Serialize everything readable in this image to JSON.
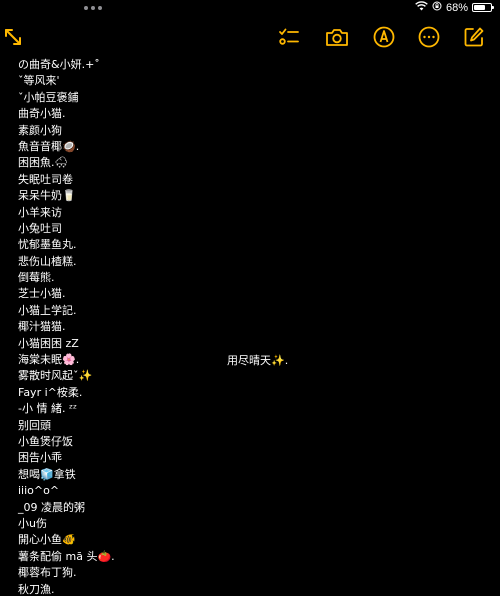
{
  "status_bar": {
    "battery_percent": "68%",
    "battery_level": 0.68,
    "icons": [
      "wifi-icon",
      "lock-rotation-icon",
      "battery-icon"
    ]
  },
  "toolbar": {
    "left": [
      "collapse-icon"
    ],
    "right": [
      "checklist-icon",
      "camera-icon",
      "markup-pen-icon",
      "more-icon",
      "compose-icon"
    ],
    "accent_color": "#ffb800"
  },
  "note": {
    "lines": [
      "の曲奇&小妍.+˚",
      "ˇ等风来'",
      "ˇ小帕豆褒鋪",
      "曲奇小猫.",
      "素颜小狗",
      "魚音音椰🥥.",
      "困困魚.🌨",
      "失眠吐司卷",
      "呆呆牛奶🥛",
      "小羊来访",
      "小兔吐司",
      "忧郁墨鱼丸.",
      "悲伤山楂糕.",
      "倒莓熊.",
      "芝士小猫.",
      "小猫上学記.",
      "椰汁猫猫.",
      "小猫困困 zZ",
      "海棠未眠🌸.",
      "雾散时风起ˇ✨",
      "Fayr i^桉柔.",
      "-小  情  緒.  ᶻᶻ",
      "别回頭",
      "小鱼煲仔饭",
      "困告小乖",
      "想喝🧊拿铁",
      "iiio^o^",
      "_09 凌晨的粥",
      "小u伤",
      "開心小鱼🐠",
      "薯条配偷 mā 头🍅.",
      "椰蓉布丁狗.",
      "秋刀漁."
    ],
    "side_text": "用尽晴天✨."
  }
}
